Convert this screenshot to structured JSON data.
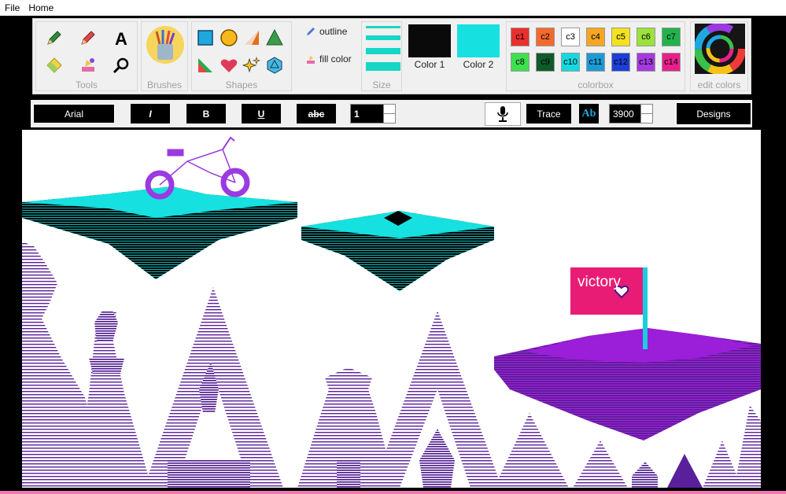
{
  "menu": {
    "file": "File",
    "home": "Home"
  },
  "toolbar": {
    "groups": {
      "tools": "Tools",
      "brushes": "Brushes",
      "shapes": "Shapes",
      "size": "Size",
      "colorbox": "colorbox",
      "edit_colors": "edit colors"
    },
    "outline_label": "outline",
    "fill_label": "fill color",
    "color1_label": "Color 1",
    "color2_label": "Color 2",
    "color1_value": "#0a0a0a",
    "color2_value": "#16e0e0",
    "swatches": [
      {
        "label": "c1",
        "color": "#e8302d"
      },
      {
        "label": "c2",
        "color": "#f26a2e"
      },
      {
        "label": "c3",
        "color": "#ffffff"
      },
      {
        "label": "c4",
        "color": "#f6a623"
      },
      {
        "label": "c5",
        "color": "#f4e11f"
      },
      {
        "label": "c6",
        "color": "#9be23a"
      },
      {
        "label": "c7",
        "color": "#22b24c"
      },
      {
        "label": "c8",
        "color": "#3fe04f"
      },
      {
        "label": "c9",
        "color": "#0f5a2a"
      },
      {
        "label": "c10",
        "color": "#16d9e0"
      },
      {
        "label": "c11",
        "color": "#1c9ad6"
      },
      {
        "label": "c12",
        "color": "#1c3fd8"
      },
      {
        "label": "c13",
        "color": "#a43ae0"
      },
      {
        "label": "c14",
        "color": "#e8208c"
      }
    ]
  },
  "fontbar": {
    "font_name": "Arial",
    "italic": "I",
    "bold": "B",
    "underline": "U",
    "strike": "abc",
    "font_size": "1",
    "trace": "Trace",
    "text_style": "Ab",
    "trace_value": "3900",
    "designs": "Designs"
  },
  "canvas": {
    "flag_text": "victory"
  }
}
